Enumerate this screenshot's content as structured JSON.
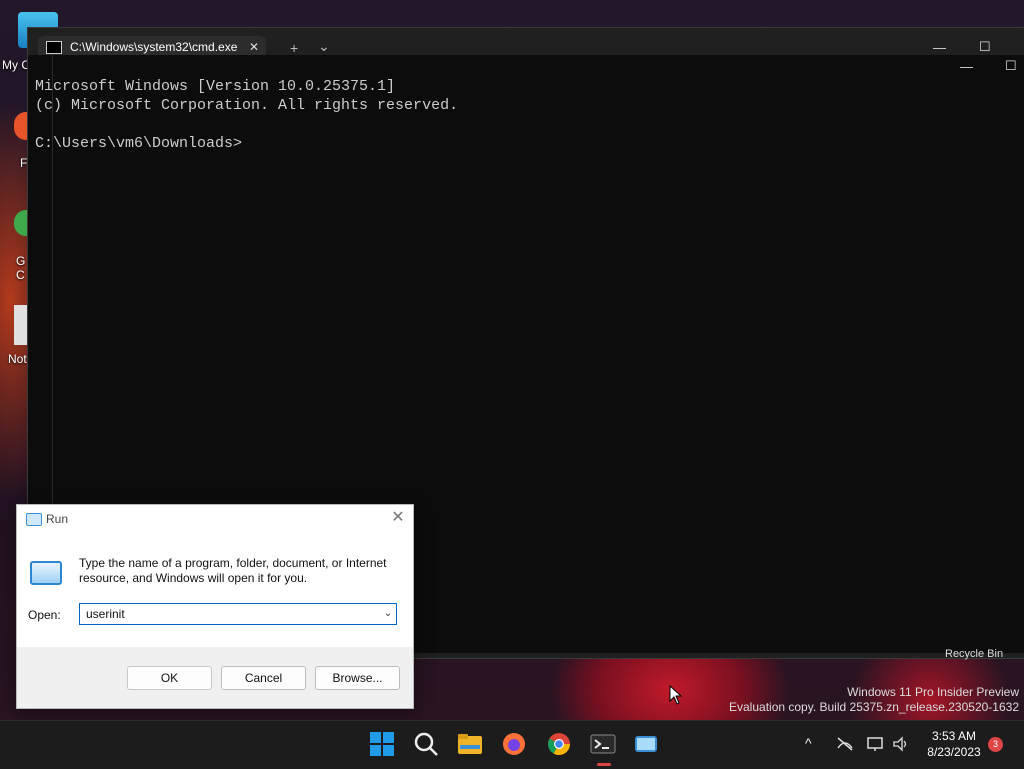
{
  "desktop": {
    "icons": [
      {
        "label": "My C"
      },
      {
        "label": "F"
      },
      {
        "label": "G\nC"
      },
      {
        "label": "Not"
      }
    ],
    "recycle_label": "Recycle Bin",
    "watermark": {
      "line1": "Windows 11 Pro Insider Preview",
      "line2": "Evaluation copy. Build 25375.zn_release.230520-1632"
    }
  },
  "terminal": {
    "tab_title": "C:\\Windows\\system32\\cmd.exe",
    "tab_close": "✕",
    "new_tab": "+",
    "dropdown": "⌄",
    "minimize": "—",
    "maximize": "☐",
    "console_lines": "Microsoft Windows [Version 10.0.25375.1]\n(c) Microsoft Corporation. All rights reserved.\n\nC:\\Users\\vm6\\Downloads>"
  },
  "run_dialog": {
    "title": "Run",
    "close": "✕",
    "description": "Type the name of a program, folder, document, or Internet resource, and Windows will open it for you.",
    "open_label": "Open:",
    "input_value": "userinit",
    "ok_label": "OK",
    "cancel_label": "Cancel",
    "browse_label": "Browse..."
  },
  "taskbar": {
    "clock_time": "3:53 AM",
    "clock_date": "8/23/2023",
    "notification_count": "3",
    "chevron": "^"
  }
}
